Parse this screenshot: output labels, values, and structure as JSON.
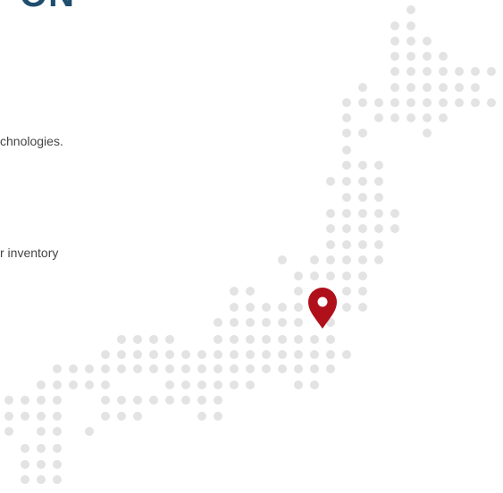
{
  "heading": {
    "text": "ON"
  },
  "body": {
    "line_1": "chnologies.",
    "line_2": "r inventory"
  },
  "map": {
    "dot_color": "#e3e3e3",
    "marker_color": "#b0101a",
    "marker_icon": "location-pin-icon"
  }
}
